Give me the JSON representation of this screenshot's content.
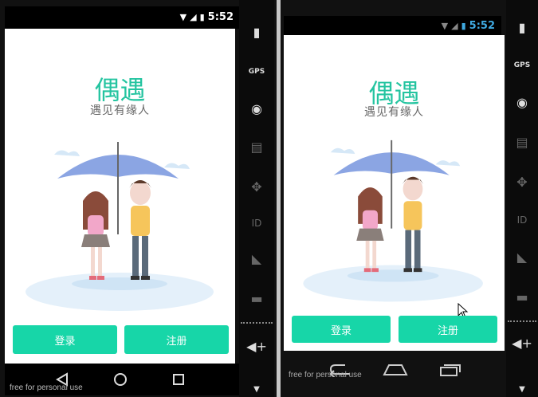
{
  "left_phone": {
    "status_time": "5:52",
    "app_title": "偶遇",
    "app_subtitle": "遇见有缘人",
    "login_label": "登录",
    "register_label": "注册",
    "watermark": "free for personal use"
  },
  "right_phone": {
    "status_time": "5:52",
    "app_title": "偶遇",
    "app_subtitle": "遇见有缘人",
    "login_label": "登录",
    "register_label": "注册",
    "watermark": "free for personal use"
  },
  "side_toolbar": {
    "gps_label": "GPS",
    "id_label": "ID"
  },
  "colors": {
    "accent": "#17d6a8",
    "title": "#24c4a0",
    "umbrella": "#7e9be0",
    "girl_shirt": "#f2a7c9",
    "boy_shirt": "#f6c55b"
  },
  "icons": [
    "battery-icon",
    "gps-icon",
    "camera-icon",
    "clapper-icon",
    "dpad-icon",
    "id-icon",
    "rss-icon",
    "sms-icon",
    "volume-up-icon",
    "back-icon",
    "home-icon",
    "recents-icon"
  ]
}
